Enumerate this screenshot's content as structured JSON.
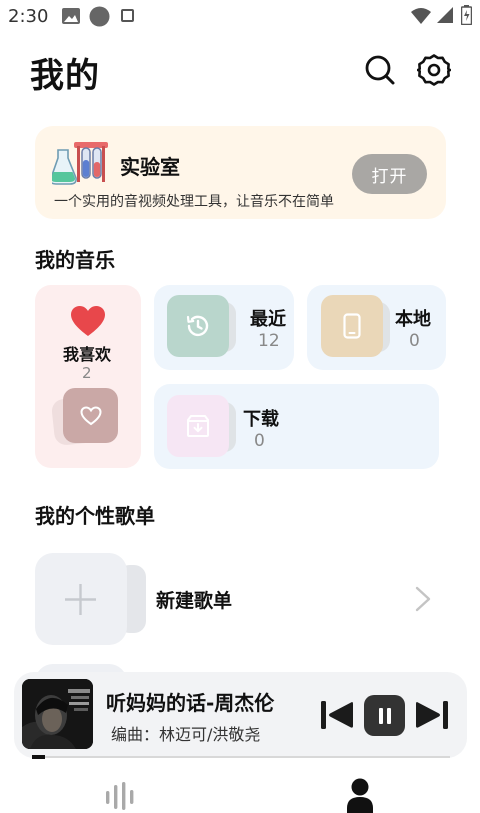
{
  "status_bar": {
    "time": "2:30",
    "icons": [
      "image-icon",
      "circle-icon",
      "square-icon",
      "wifi-icon",
      "signal-icon",
      "battery-icon"
    ]
  },
  "header": {
    "title": "我的",
    "actions": [
      "search-icon",
      "settings-icon"
    ]
  },
  "lab": {
    "title": "实验室",
    "description": "一个实用的音视频处理工具，让音乐不在简单",
    "button": "打开",
    "icon": "lab-flask-icon"
  },
  "my_music": {
    "title": "我的音乐",
    "favorites": {
      "label": "我喜欢",
      "count": "2",
      "icon": "heart-icon"
    },
    "recent": {
      "label": "最近",
      "count": "12",
      "icon": "clock-icon",
      "tile_color": "#b9d6cc"
    },
    "local": {
      "label": "本地",
      "count": "0",
      "icon": "phone-icon",
      "tile_color": "#ead7b8"
    },
    "downloads": {
      "label": "下载",
      "count": "0",
      "icon": "download-box-icon",
      "tile_color": "#f6e6f4"
    }
  },
  "playlists": {
    "title": "我的个性歌单",
    "new_playlist_label": "新建歌单",
    "icons": [
      "plus-icon",
      "chevron-right-icon"
    ]
  },
  "player": {
    "song": "听妈妈的话-周杰伦",
    "meta": "编曲：林迈可/洪敬尧",
    "progress": 0.03,
    "controls": [
      "previous-icon",
      "pause-icon",
      "next-icon"
    ]
  },
  "bottom_nav": {
    "items": [
      "music-bars-icon",
      "profile-icon"
    ],
    "active": "profile-icon"
  },
  "colors": {
    "accent_red": "#e8474b",
    "lab_bg": "#fff6e9",
    "card_blue": "#eef5fc",
    "card_pink": "#fdeeee",
    "open_button": "#a9a7a4"
  }
}
